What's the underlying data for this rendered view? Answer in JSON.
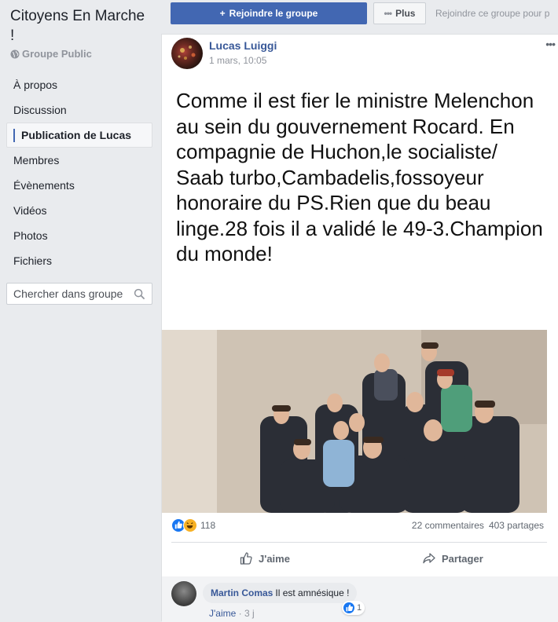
{
  "sidebar": {
    "group_name": "Citoyens En Marche !",
    "group_type": "Groupe Public",
    "nav": [
      {
        "label": "À propos"
      },
      {
        "label": "Discussion"
      },
      {
        "label": "Publication de Lucas"
      },
      {
        "label": "Membres"
      },
      {
        "label": "Évènements"
      },
      {
        "label": "Vidéos"
      },
      {
        "label": "Photos"
      },
      {
        "label": "Fichiers"
      }
    ],
    "active_index": 2,
    "search_placeholder": "Chercher dans groupe"
  },
  "header": {
    "join_label": "Rejoindre le groupe",
    "more_label": "Plus",
    "join_hint": "Rejoindre ce groupe pour p"
  },
  "post": {
    "author": "Lucas Luiggi",
    "time": "1 mars, 10:05",
    "menu": "•••",
    "image_text": "Comme il est fier le ministre Melenchon au sein du gouvernement Rocard. En compagnie de Huchon,le socialiste/ Saab turbo,Cambadelis,fossoyeur honoraire du PS.Rien que du beau linge.28 fois il a validé le 49-3.Champion du monde!",
    "reactions_count": "118",
    "comments_count": "22 commentaires",
    "shares_count": "403 partages",
    "like_label": "J'aime",
    "share_label": "Partager"
  },
  "comment": {
    "author": "Martin Comas",
    "text": "Il est amnésique !",
    "like_count": "1",
    "like_link": "J'aime",
    "separator": "·",
    "age": "3 j"
  },
  "colors": {
    "accent": "#4267b2",
    "link": "#385898",
    "background": "#e9ebee"
  }
}
